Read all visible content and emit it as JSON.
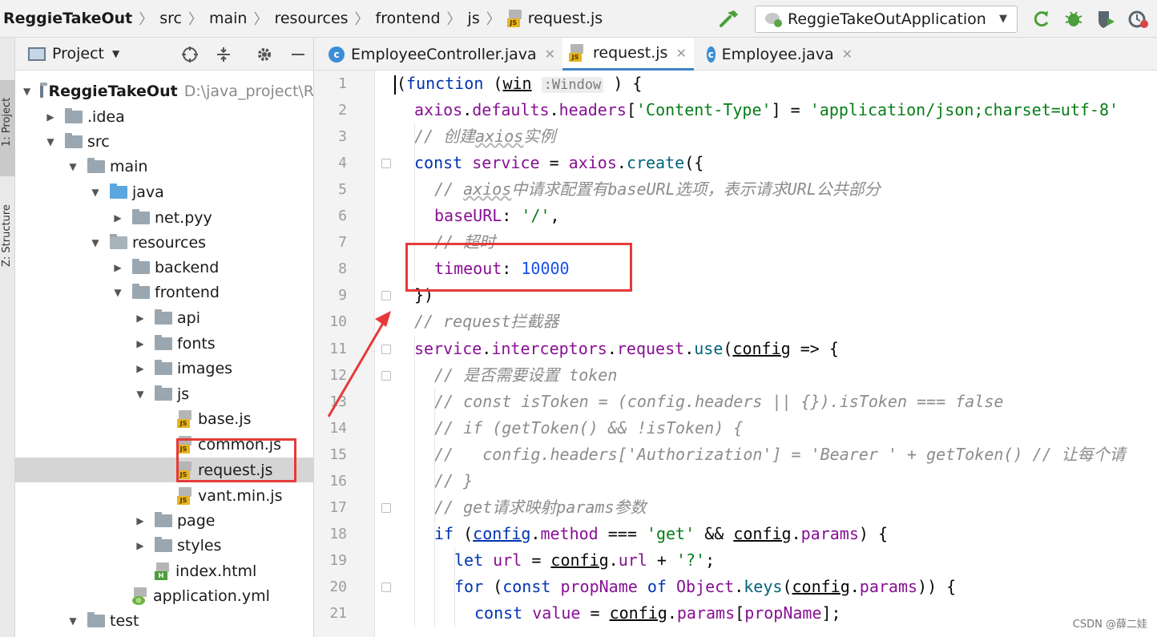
{
  "breadcrumb": [
    "ReggieTakeOut",
    "src",
    "main",
    "resources",
    "frontend",
    "js",
    "request.js"
  ],
  "run_config": "ReggieTakeOutApplication",
  "tool_stripe": {
    "project": "1: Project",
    "structure": "Z: Structure"
  },
  "project_panel": {
    "title": "Project",
    "tree": [
      {
        "label": "ReggieTakeOut",
        "path": "D:\\java_project\\R",
        "level": 0,
        "expanded": true,
        "kind": "module"
      },
      {
        "label": ".idea",
        "level": 1,
        "expanded": false,
        "kind": "folder"
      },
      {
        "label": "src",
        "level": 1,
        "expanded": true,
        "kind": "folder"
      },
      {
        "label": "main",
        "level": 2,
        "expanded": true,
        "kind": "folder"
      },
      {
        "label": "java",
        "level": 3,
        "expanded": true,
        "kind": "folder-blue"
      },
      {
        "label": "net.pyy",
        "level": 4,
        "expanded": false,
        "kind": "package"
      },
      {
        "label": "resources",
        "level": 3,
        "expanded": true,
        "kind": "folder-res"
      },
      {
        "label": "backend",
        "level": 4,
        "expanded": false,
        "kind": "folder"
      },
      {
        "label": "frontend",
        "level": 4,
        "expanded": true,
        "kind": "folder"
      },
      {
        "label": "api",
        "level": 5,
        "expanded": false,
        "kind": "folder"
      },
      {
        "label": "fonts",
        "level": 5,
        "expanded": false,
        "kind": "folder"
      },
      {
        "label": "images",
        "level": 5,
        "expanded": false,
        "kind": "folder"
      },
      {
        "label": "js",
        "level": 5,
        "expanded": true,
        "kind": "folder"
      },
      {
        "label": "base.js",
        "level": 6,
        "kind": "js"
      },
      {
        "label": "common.js",
        "level": 6,
        "kind": "js"
      },
      {
        "label": "request.js",
        "level": 6,
        "kind": "js",
        "selected": true
      },
      {
        "label": "vant.min.js",
        "level": 6,
        "kind": "minjs"
      },
      {
        "label": "page",
        "level": 5,
        "expanded": false,
        "kind": "folder"
      },
      {
        "label": "styles",
        "level": 5,
        "expanded": false,
        "kind": "folder"
      },
      {
        "label": "index.html",
        "level": 5,
        "kind": "html"
      },
      {
        "label": "application.yml",
        "level": 4,
        "kind": "yml"
      },
      {
        "label": "test",
        "level": 2,
        "expanded": true,
        "kind": "folder"
      }
    ]
  },
  "editor_tabs": [
    {
      "label": "EmployeeController.java",
      "icon": "class-icon",
      "active": false
    },
    {
      "label": "request.js",
      "icon": "js-file-icon",
      "active": true
    },
    {
      "label": "Employee.java",
      "icon": "class-icon",
      "active": false
    }
  ],
  "code_lines": [
    {
      "n": "1",
      "indent": 0,
      "tokens": [
        [
          "cursor",
          ""
        ],
        [
          "par",
          "("
        ],
        [
          "kw",
          "function"
        ],
        [
          "par",
          " ("
        ],
        [
          "par ul",
          "win"
        ],
        [
          "par",
          " "
        ],
        [
          "hint",
          ":Window"
        ],
        [
          "par",
          " ) {"
        ]
      ]
    },
    {
      "n": "2",
      "indent": 1,
      "tokens": [
        [
          "prop",
          "axios"
        ],
        [
          "par",
          "."
        ],
        [
          "prop",
          "defaults"
        ],
        [
          "par",
          "."
        ],
        [
          "prop",
          "headers"
        ],
        [
          "par",
          "["
        ],
        [
          "str",
          "'Content-Type'"
        ],
        [
          "par",
          "] = "
        ],
        [
          "str",
          "'application/json;charset=utf-8'"
        ]
      ]
    },
    {
      "n": "3",
      "indent": 1,
      "tokens": [
        [
          "cm",
          "// 创建"
        ],
        [
          "cm wavy",
          "axios"
        ],
        [
          "cm",
          "实例"
        ]
      ]
    },
    {
      "n": "4",
      "indent": 1,
      "tokens": [
        [
          "kw",
          "const "
        ],
        [
          "prop",
          "service"
        ],
        [
          "par",
          " = "
        ],
        [
          "prop",
          "axios"
        ],
        [
          "par",
          "."
        ],
        [
          "fn",
          "create"
        ],
        [
          "par",
          "({"
        ]
      ]
    },
    {
      "n": "5",
      "indent": 2,
      "tokens": [
        [
          "cm",
          "// "
        ],
        [
          "cm wavy",
          "axios"
        ],
        [
          "cm",
          "中请求配置有baseURL选项，表示请求URL公共部分"
        ]
      ]
    },
    {
      "n": "6",
      "indent": 2,
      "tokens": [
        [
          "prop",
          "baseURL"
        ],
        [
          "par",
          ": "
        ],
        [
          "str",
          "'/'"
        ],
        [
          "par",
          ","
        ]
      ]
    },
    {
      "n": "7",
      "indent": 2,
      "tokens": [
        [
          "cm",
          "// 超时"
        ]
      ]
    },
    {
      "n": "8",
      "indent": 2,
      "tokens": [
        [
          "prop",
          "timeout"
        ],
        [
          "par",
          ": "
        ],
        [
          "num",
          "10000"
        ]
      ]
    },
    {
      "n": "9",
      "indent": 1,
      "tokens": [
        [
          "par",
          "})"
        ]
      ]
    },
    {
      "n": "10",
      "indent": 1,
      "tokens": [
        [
          "cm",
          "// request拦截器"
        ]
      ]
    },
    {
      "n": "11",
      "indent": 1,
      "tokens": [
        [
          "prop",
          "service"
        ],
        [
          "par",
          "."
        ],
        [
          "prop",
          "interceptors"
        ],
        [
          "par",
          "."
        ],
        [
          "prop",
          "request"
        ],
        [
          "par",
          "."
        ],
        [
          "fn",
          "use"
        ],
        [
          "par",
          "("
        ],
        [
          "par ul",
          "config"
        ],
        [
          "par",
          " => {"
        ]
      ]
    },
    {
      "n": "12",
      "indent": 2,
      "tokens": [
        [
          "cm",
          "// 是否需要设置 token"
        ]
      ]
    },
    {
      "n": "13",
      "indent": 2,
      "tokens": [
        [
          "cm",
          "// const isToken = (config.headers || {}).isToken === false"
        ]
      ]
    },
    {
      "n": "14",
      "indent": 2,
      "tokens": [
        [
          "cm",
          "// if (getToken() && !isToken) {"
        ]
      ]
    },
    {
      "n": "15",
      "indent": 2,
      "tokens": [
        [
          "cm",
          "//   config.headers['Authorization'] = 'Bearer ' + getToken() // 让每个请"
        ]
      ]
    },
    {
      "n": "16",
      "indent": 2,
      "tokens": [
        [
          "cm",
          "// }"
        ]
      ]
    },
    {
      "n": "17",
      "indent": 2,
      "tokens": [
        [
          "cm",
          "// get请求映射params参数"
        ]
      ]
    },
    {
      "n": "18",
      "indent": 2,
      "tokens": [
        [
          "kw",
          "if "
        ],
        [
          "par",
          "("
        ],
        [
          "kw ul",
          "config"
        ],
        [
          "par",
          "."
        ],
        [
          "prop",
          "method"
        ],
        [
          "par",
          " === "
        ],
        [
          "str",
          "'get'"
        ],
        [
          "par",
          " && "
        ],
        [
          "par ul",
          "config"
        ],
        [
          "par",
          "."
        ],
        [
          "prop",
          "params"
        ],
        [
          "par",
          ") {"
        ]
      ]
    },
    {
      "n": "19",
      "indent": 3,
      "tokens": [
        [
          "kw",
          "let "
        ],
        [
          "prop",
          "url"
        ],
        [
          "par",
          " = "
        ],
        [
          "par ul",
          "config"
        ],
        [
          "par",
          "."
        ],
        [
          "prop",
          "url"
        ],
        [
          "par",
          " + "
        ],
        [
          "str",
          "'?'"
        ],
        [
          "par",
          ";"
        ]
      ]
    },
    {
      "n": "20",
      "indent": 3,
      "tokens": [
        [
          "kw",
          "for "
        ],
        [
          "par",
          "("
        ],
        [
          "kw",
          "const "
        ],
        [
          "prop",
          "propName"
        ],
        [
          "par",
          " "
        ],
        [
          "kw",
          "of "
        ],
        [
          "prop",
          "Object"
        ],
        [
          "par",
          "."
        ],
        [
          "fn",
          "keys"
        ],
        [
          "par",
          "("
        ],
        [
          "par ul",
          "config"
        ],
        [
          "par",
          "."
        ],
        [
          "prop",
          "params"
        ],
        [
          "par",
          ")) {"
        ]
      ]
    },
    {
      "n": "21",
      "indent": 4,
      "tokens": [
        [
          "kw",
          "const "
        ],
        [
          "prop",
          "value"
        ],
        [
          "par",
          " = "
        ],
        [
          "par ul",
          "config"
        ],
        [
          "par",
          "."
        ],
        [
          "prop",
          "params"
        ],
        [
          "par",
          "["
        ],
        [
          "prop",
          "propName"
        ],
        [
          "par",
          "];"
        ]
      ]
    }
  ],
  "watermark": "CSDN @薛二娃",
  "accent": "#e53a3a"
}
